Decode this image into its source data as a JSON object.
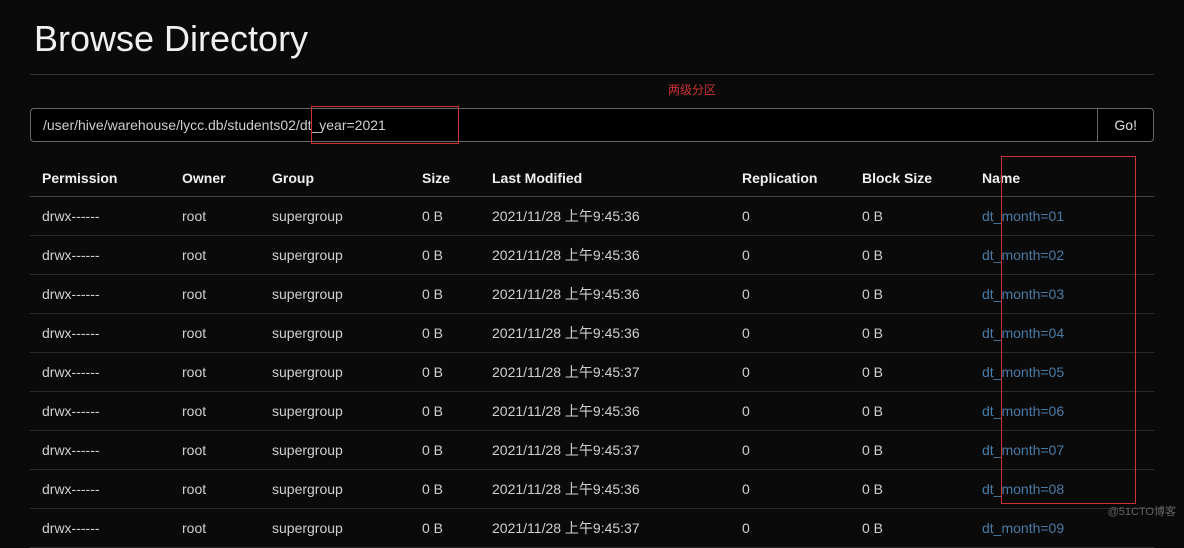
{
  "title": "Browse Directory",
  "annotation": "两级分区",
  "path": "/user/hive/warehouse/lycc.db/students02/dt_year=2021",
  "go_label": "Go!",
  "watermark": "@51CTO博客",
  "columns": {
    "permission": "Permission",
    "owner": "Owner",
    "group": "Group",
    "size": "Size",
    "last_modified": "Last Modified",
    "replication": "Replication",
    "block_size": "Block Size",
    "name": "Name"
  },
  "rows": [
    {
      "permission": "drwx------",
      "owner": "root",
      "group": "supergroup",
      "size": "0 B",
      "last_modified": "2021/11/28 上午9:45:36",
      "replication": "0",
      "block_size": "0 B",
      "name": "dt_month=01"
    },
    {
      "permission": "drwx------",
      "owner": "root",
      "group": "supergroup",
      "size": "0 B",
      "last_modified": "2021/11/28 上午9:45:36",
      "replication": "0",
      "block_size": "0 B",
      "name": "dt_month=02"
    },
    {
      "permission": "drwx------",
      "owner": "root",
      "group": "supergroup",
      "size": "0 B",
      "last_modified": "2021/11/28 上午9:45:36",
      "replication": "0",
      "block_size": "0 B",
      "name": "dt_month=03"
    },
    {
      "permission": "drwx------",
      "owner": "root",
      "group": "supergroup",
      "size": "0 B",
      "last_modified": "2021/11/28 上午9:45:36",
      "replication": "0",
      "block_size": "0 B",
      "name": "dt_month=04"
    },
    {
      "permission": "drwx------",
      "owner": "root",
      "group": "supergroup",
      "size": "0 B",
      "last_modified": "2021/11/28 上午9:45:37",
      "replication": "0",
      "block_size": "0 B",
      "name": "dt_month=05"
    },
    {
      "permission": "drwx------",
      "owner": "root",
      "group": "supergroup",
      "size": "0 B",
      "last_modified": "2021/11/28 上午9:45:36",
      "replication": "0",
      "block_size": "0 B",
      "name": "dt_month=06"
    },
    {
      "permission": "drwx------",
      "owner": "root",
      "group": "supergroup",
      "size": "0 B",
      "last_modified": "2021/11/28 上午9:45:37",
      "replication": "0",
      "block_size": "0 B",
      "name": "dt_month=07"
    },
    {
      "permission": "drwx------",
      "owner": "root",
      "group": "supergroup",
      "size": "0 B",
      "last_modified": "2021/11/28 上午9:45:36",
      "replication": "0",
      "block_size": "0 B",
      "name": "dt_month=08"
    },
    {
      "permission": "drwx------",
      "owner": "root",
      "group": "supergroup",
      "size": "0 B",
      "last_modified": "2021/11/28 上午9:45:37",
      "replication": "0",
      "block_size": "0 B",
      "name": "dt_month=09"
    }
  ]
}
